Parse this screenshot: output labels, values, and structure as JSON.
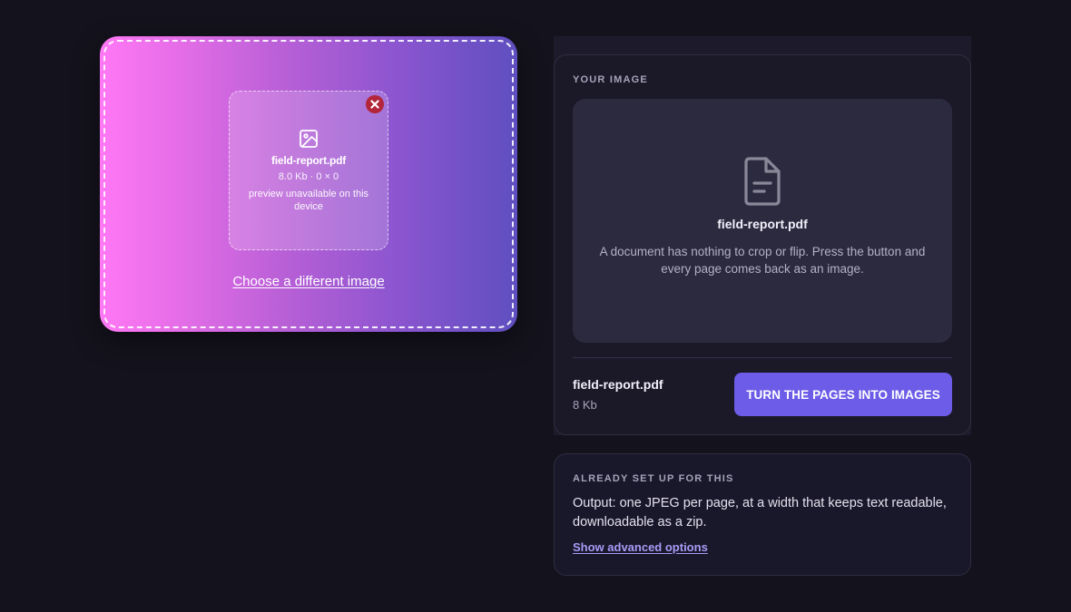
{
  "dropzone": {
    "file": {
      "name": "field-report.pdf",
      "meta": "8.0 Kb · 0 × 0",
      "note": "preview unavailable on this device"
    },
    "choose_label": "Choose a different image",
    "icons": {
      "preview": "image-icon",
      "remove": "close-icon"
    }
  },
  "panel": {
    "label": "YOUR IMAGE",
    "preview": {
      "icon": "document-icon",
      "name": "field-report.pdf",
      "description": "A document has nothing to crop or flip. Press the button and every page comes back as an image."
    },
    "file_name": "field-report.pdf",
    "file_size": "8 Kb",
    "button_label": "TURN THE PAGES INTO IMAGES"
  },
  "preset": {
    "label": "ALREADY SET UP FOR THIS",
    "text": "Output: one JPEG per page, at a width that keeps text readable, downloadable as a zip.",
    "link_label": "Show advanced options"
  },
  "colors": {
    "background": "#14131d",
    "accent": "#6c5ce7",
    "gradient_start": "#ff78f5",
    "gradient_end": "#5f4fc0",
    "remove_button": "#b3263a",
    "link": "#a79cf7"
  }
}
